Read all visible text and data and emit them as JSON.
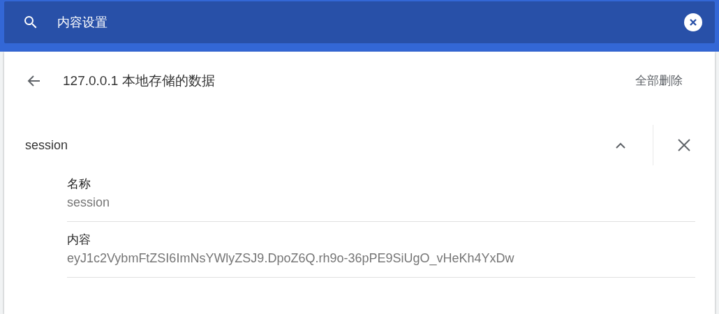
{
  "search": {
    "value": "内容设置"
  },
  "header": {
    "title": "127.0.0.1 本地存储的数据",
    "remove_all": "全部删除"
  },
  "items": [
    {
      "name": "session",
      "expanded": true,
      "fields": [
        {
          "label": "名称",
          "value": "session"
        },
        {
          "label": "内容",
          "value": "eyJ1c2VybmFtZSI6ImNsYWlyZSJ9.DpoZ6Q.rh9o-36pPE9SiUgO_vHeKh4YxDw"
        }
      ]
    }
  ]
}
